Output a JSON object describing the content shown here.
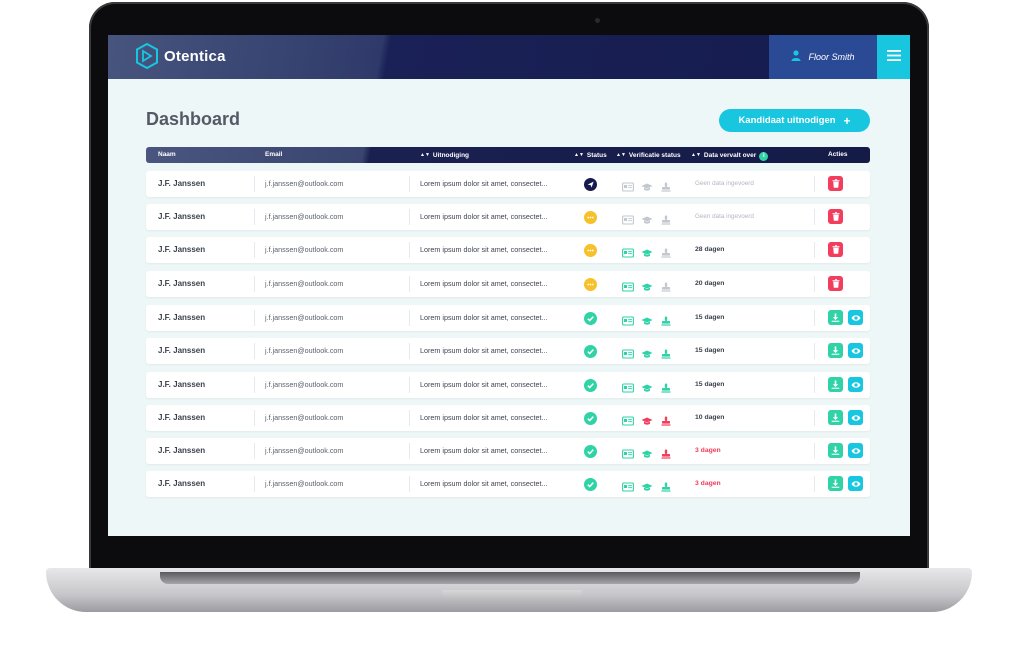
{
  "app": {
    "name": "Otentica"
  },
  "user": {
    "name": "Floor Smith"
  },
  "page": {
    "title": "Dashboard",
    "invite_label": "Kandidaat uitnodigen"
  },
  "table": {
    "columns": {
      "name": "Naam",
      "email": "Email",
      "invitation": "Uitnodiging",
      "status": "Status",
      "verification": "Verificatie status",
      "expiry": "Data vervalt over",
      "actions": "Acties"
    },
    "rows": [
      {
        "name": "J.F. Janssen",
        "email": "j.f.janssen@outlook.com",
        "invitation": "Lorem ipsum dolor sit amet, consectet...",
        "status": "sent",
        "verification": [
          "grey",
          "grey",
          "grey"
        ],
        "expiry": "Geen data ingevoerd",
        "expiry_style": "none",
        "actions": [
          "delete"
        ]
      },
      {
        "name": "J.F. Janssen",
        "email": "j.f.janssen@outlook.com",
        "invitation": "Lorem ipsum dolor sit amet, consectet...",
        "status": "pending",
        "verification": [
          "grey",
          "grey",
          "grey"
        ],
        "expiry": "Geen data ingevoerd",
        "expiry_style": "none",
        "actions": [
          "delete"
        ]
      },
      {
        "name": "J.F. Janssen",
        "email": "j.f.janssen@outlook.com",
        "invitation": "Lorem ipsum dolor sit amet, consectet...",
        "status": "pending",
        "verification": [
          "teal",
          "teal",
          "grey"
        ],
        "expiry": "28 dagen",
        "expiry_style": "normal",
        "actions": [
          "delete"
        ]
      },
      {
        "name": "J.F. Janssen",
        "email": "j.f.janssen@outlook.com",
        "invitation": "Lorem ipsum dolor sit amet, consectet...",
        "status": "pending",
        "verification": [
          "teal",
          "teal",
          "grey"
        ],
        "expiry": "20 dagen",
        "expiry_style": "normal",
        "actions": [
          "delete"
        ]
      },
      {
        "name": "J.F. Janssen",
        "email": "j.f.janssen@outlook.com",
        "invitation": "Lorem ipsum dolor sit amet, consectet...",
        "status": "done",
        "verification": [
          "teal",
          "teal",
          "teal"
        ],
        "expiry": "15 dagen",
        "expiry_style": "normal",
        "actions": [
          "download",
          "view"
        ]
      },
      {
        "name": "J.F. Janssen",
        "email": "j.f.janssen@outlook.com",
        "invitation": "Lorem ipsum dolor sit amet, consectet...",
        "status": "done",
        "verification": [
          "teal",
          "teal",
          "teal"
        ],
        "expiry": "15 dagen",
        "expiry_style": "normal",
        "actions": [
          "download",
          "view"
        ]
      },
      {
        "name": "J.F. Janssen",
        "email": "j.f.janssen@outlook.com",
        "invitation": "Lorem ipsum dolor sit amet, consectet...",
        "status": "done",
        "verification": [
          "teal",
          "teal",
          "teal"
        ],
        "expiry": "15 dagen",
        "expiry_style": "normal",
        "actions": [
          "download",
          "view"
        ]
      },
      {
        "name": "J.F. Janssen",
        "email": "j.f.janssen@outlook.com",
        "invitation": "Lorem ipsum dolor sit amet, consectet...",
        "status": "done",
        "verification": [
          "teal",
          "red",
          "red"
        ],
        "expiry": "10 dagen",
        "expiry_style": "normal",
        "actions": [
          "download",
          "view"
        ]
      },
      {
        "name": "J.F. Janssen",
        "email": "j.f.janssen@outlook.com",
        "invitation": "Lorem ipsum dolor sit amet, consectet...",
        "status": "done",
        "verification": [
          "teal",
          "teal",
          "red"
        ],
        "expiry": "3 dagen",
        "expiry_style": "danger",
        "actions": [
          "download",
          "view"
        ]
      },
      {
        "name": "J.F. Janssen",
        "email": "j.f.janssen@outlook.com",
        "invitation": "Lorem ipsum dolor sit amet, consectet...",
        "status": "done",
        "verification": [
          "teal",
          "teal",
          "teal"
        ],
        "expiry": "3 dagen",
        "expiry_style": "danger",
        "actions": [
          "download",
          "view"
        ]
      }
    ]
  },
  "colors": {
    "accent": "#18c6e0",
    "navy": "#151b4d",
    "success": "#2fd3a6",
    "warning": "#f6c12b",
    "danger": "#f23d5c",
    "muted": "#c3c8cf"
  },
  "icons": {
    "status": {
      "sent": "paper-plane-icon",
      "pending": "more-dots-icon",
      "done": "check-icon"
    },
    "verification": [
      "id-card-icon",
      "graduation-cap-icon",
      "stamp-icon"
    ],
    "actions": {
      "delete": "trash-icon",
      "download": "download-icon",
      "view": "eye-icon"
    }
  }
}
